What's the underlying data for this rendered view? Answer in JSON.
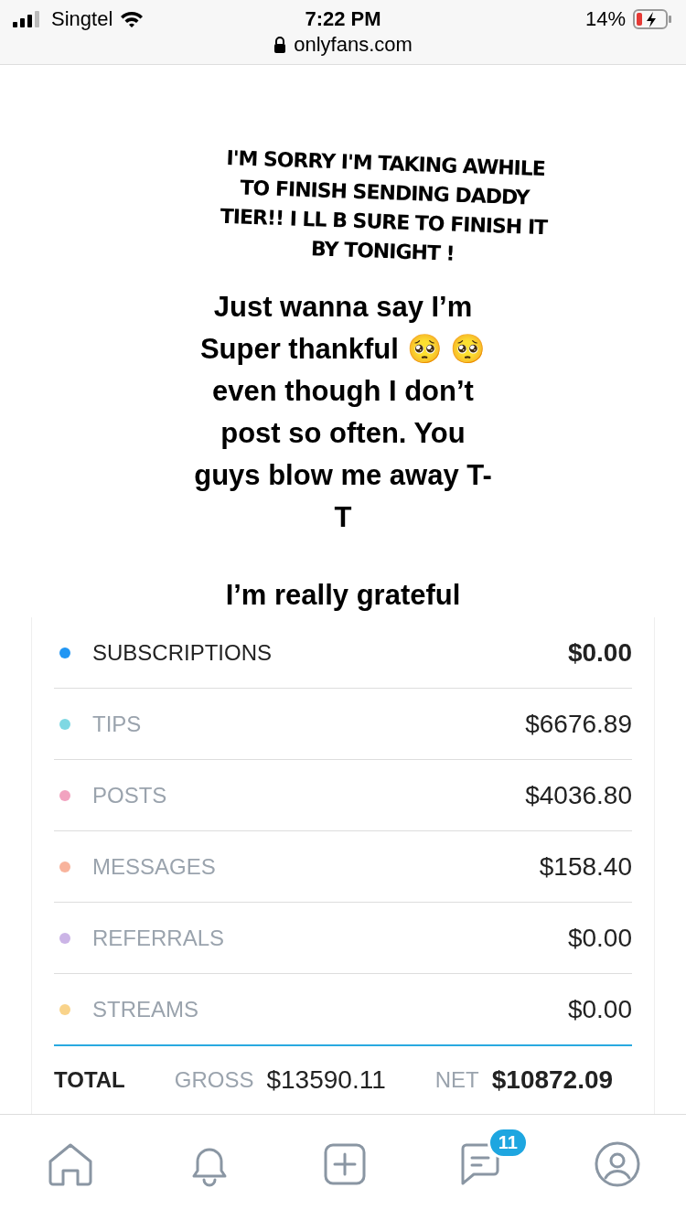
{
  "status_bar": {
    "carrier": "Singtel",
    "time": "7:22 PM",
    "battery": "14%",
    "url": "onlyfans.com"
  },
  "overlay": {
    "note": "I'M SORRY I'M TAKING AWHILE TO FINISH SENDING DADDY TIER!! I LL B SURE TO FINISH IT BY TONIGHT !",
    "message": "Just wanna say I’m Super thankful 🥺 🥺 even though I don’t post so often. You guys blow me away T-T",
    "footer": "I’m really grateful"
  },
  "earnings": [
    {
      "label": "SUBSCRIPTIONS",
      "amount": "$0.00",
      "color": "#2196f3",
      "selected": true
    },
    {
      "label": "TIPS",
      "amount": "$6676.89",
      "color": "#7fd8e3",
      "selected": false
    },
    {
      "label": "POSTS",
      "amount": "$4036.80",
      "color": "#f2a3c0",
      "selected": false
    },
    {
      "label": "MESSAGES",
      "amount": "$158.40",
      "color": "#f8b39c",
      "selected": false
    },
    {
      "label": "REFERRALS",
      "amount": "$0.00",
      "color": "#cbb4e6",
      "selected": false
    },
    {
      "label": "STREAMS",
      "amount": "$0.00",
      "color": "#f9d38a",
      "selected": false
    }
  ],
  "total": {
    "label": "TOTAL",
    "gross_label": "GROSS",
    "gross": "$13590.11",
    "net_label": "NET",
    "net": "$10872.09"
  },
  "nav": [
    {
      "kind": "home"
    },
    {
      "kind": "bell"
    },
    {
      "kind": "add"
    },
    {
      "kind": "messages",
      "badge": "11"
    },
    {
      "kind": "profile"
    }
  ]
}
